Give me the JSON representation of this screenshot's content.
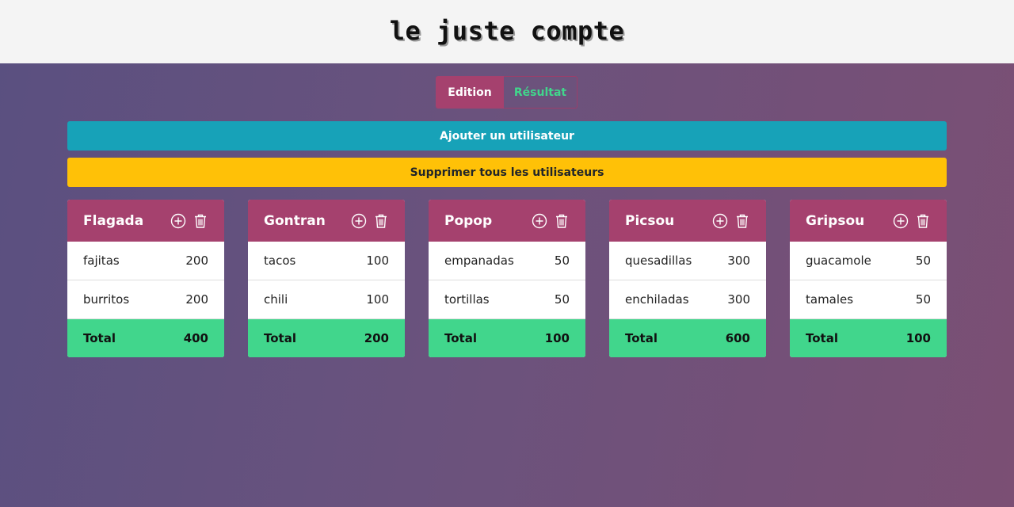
{
  "header": {
    "title": "le juste compte"
  },
  "tabs": [
    {
      "label": "Edition",
      "active": true
    },
    {
      "label": "Résultat",
      "active": false
    }
  ],
  "actions": {
    "add_user_label": "Ajouter un utilisateur",
    "delete_all_label": "Supprimer tous les utilisateurs"
  },
  "colors": {
    "header_bg": "#f4f4f4",
    "accent": "#a5416e",
    "add_button": "#17a2b8",
    "delete_button": "#ffc107",
    "total_bg": "#41d68c"
  },
  "users": [
    {
      "name": "Flagada",
      "items": [
        {
          "label": "fajitas",
          "value": "200"
        },
        {
          "label": "burritos",
          "value": "200"
        }
      ],
      "total_label": "Total",
      "total": "400"
    },
    {
      "name": "Gontran",
      "items": [
        {
          "label": "tacos",
          "value": "100"
        },
        {
          "label": "chili",
          "value": "100"
        }
      ],
      "total_label": "Total",
      "total": "200"
    },
    {
      "name": "Popop",
      "items": [
        {
          "label": "empanadas",
          "value": "50"
        },
        {
          "label": "tortillas",
          "value": "50"
        }
      ],
      "total_label": "Total",
      "total": "100"
    },
    {
      "name": "Picsou",
      "items": [
        {
          "label": "quesadillas",
          "value": "300"
        },
        {
          "label": "enchiladas",
          "value": "300"
        }
      ],
      "total_label": "Total",
      "total": "600"
    },
    {
      "name": "Gripsou",
      "items": [
        {
          "label": "guacamole",
          "value": "50"
        },
        {
          "label": "tamales",
          "value": "50"
        }
      ],
      "total_label": "Total",
      "total": "100"
    }
  ]
}
